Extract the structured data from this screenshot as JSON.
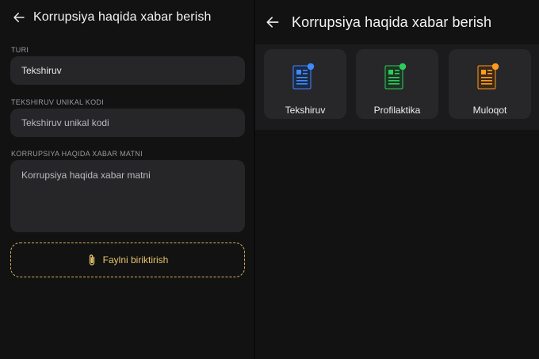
{
  "left": {
    "title": "Korrupsiya haqida xabar berish",
    "fields": [
      {
        "label": "TURI",
        "value": "Tekshiruv"
      },
      {
        "label": "TEKSHIRUV UNIKAL KODI",
        "placeholder": "Tekshiruv unikal kodi"
      },
      {
        "label": "KORRUPSIYA HAQIDA XABAR MATNI",
        "placeholder": "Korrupsiya haqida xabar matni"
      }
    ],
    "attach_label": "Faylni biriktirish"
  },
  "right": {
    "title": "Korrupsiya haqida xabar berish",
    "cards": [
      {
        "label": "Tekshiruv",
        "icon": "document-icon",
        "accent": "#3d8bff"
      },
      {
        "label": "Profilaktika",
        "icon": "document-icon",
        "accent": "#2ecc5a"
      },
      {
        "label": "Muloqot",
        "icon": "document-icon",
        "accent": "#ff9a1f"
      }
    ]
  },
  "colors": {
    "background": "#121213",
    "field": "#262629",
    "attach_accent": "#e8c46a"
  }
}
